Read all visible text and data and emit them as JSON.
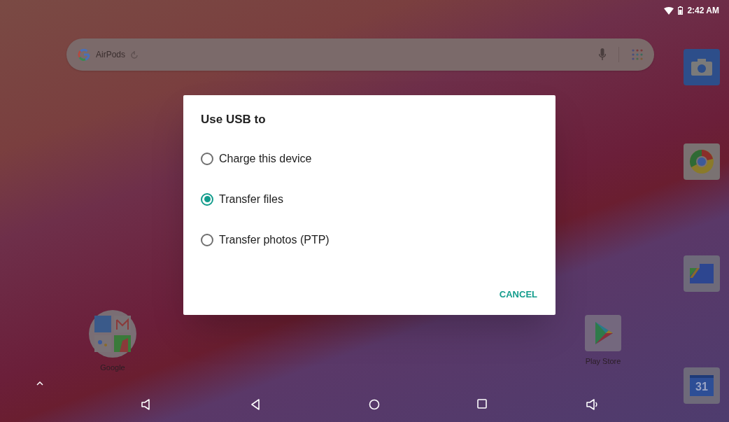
{
  "status_bar": {
    "time": "2:42 AM"
  },
  "search": {
    "placeholder": "AirPods"
  },
  "dock": [
    {
      "kind": "camera"
    },
    {
      "kind": "browser"
    },
    {
      "kind": "files"
    },
    {
      "kind": "calendar",
      "text": "31"
    }
  ],
  "home_apps": [
    {
      "kind": "folder",
      "label": "Google"
    },
    {
      "kind": "store",
      "label": "Play Store"
    }
  ],
  "dialog": {
    "title": "Use USB to",
    "options": [
      {
        "label": "Charge this device",
        "selected": false
      },
      {
        "label": "Transfer files",
        "selected": true
      },
      {
        "label": "Transfer photos (PTP)",
        "selected": false
      }
    ],
    "button": "CANCEL"
  }
}
